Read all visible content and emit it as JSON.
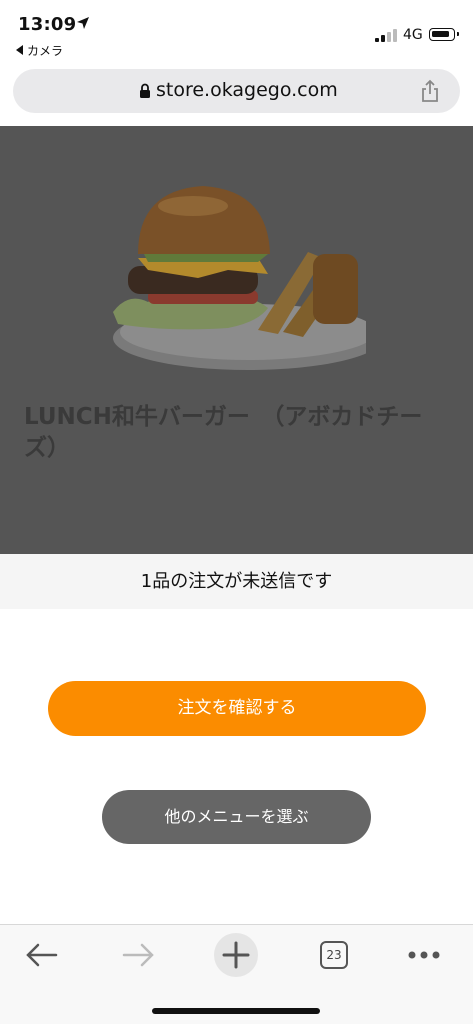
{
  "status_bar": {
    "time": "13:09",
    "back_app_label": "カメラ",
    "network": "4G"
  },
  "url_bar": {
    "url": "store.okagego.com"
  },
  "product": {
    "name": "LUNCH和牛バーガー　（アボカドチーズ）",
    "image_alt": "wagyu-burger-photo"
  },
  "order_banner": {
    "text": "1品の注文が未送信です"
  },
  "actions": {
    "confirm_label": "注文を確認する",
    "other_menu_label": "他のメニューを選ぶ"
  },
  "toolbar": {
    "tab_count": "23"
  },
  "colors": {
    "accent": "#fb8c00",
    "overlay": "#555555",
    "secondary_button": "#666666"
  },
  "icons": [
    "location-arrow-icon",
    "signal-icon",
    "battery-icon",
    "lock-icon",
    "share-icon",
    "back-arrow-icon",
    "forward-arrow-icon",
    "new-tab-plus-icon",
    "tabs-icon",
    "more-icon"
  ]
}
